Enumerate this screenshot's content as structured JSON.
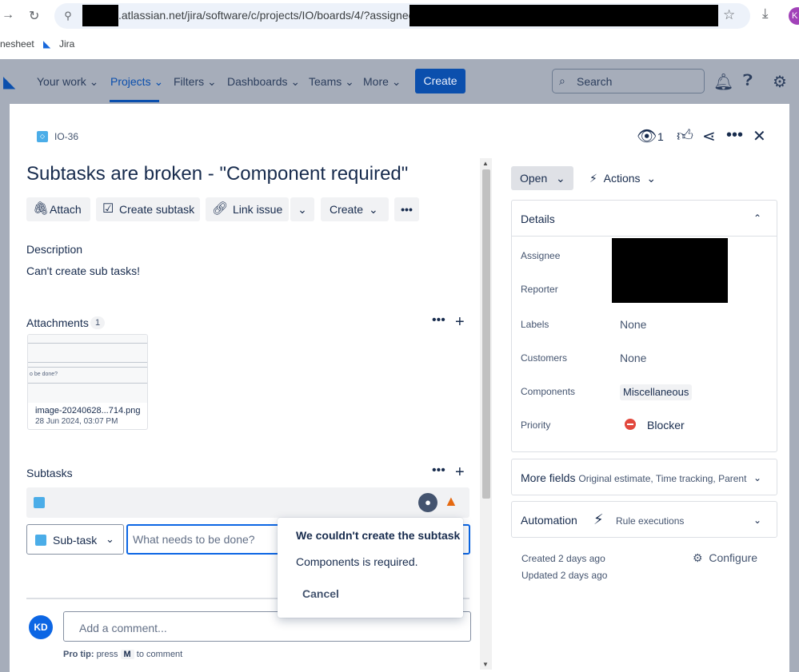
{
  "browser": {
    "url_visible": ".atlassian.net/jira/software/c/projects/IO/boards/4/?assignee=",
    "profile_initial": "K",
    "bookmarks": [
      "nesheet",
      "Jira"
    ]
  },
  "nav": {
    "items": [
      "Your work",
      "Projects",
      "Filters",
      "Dashboards",
      "Teams",
      "More"
    ],
    "create_label": "Create",
    "search_placeholder": "Search"
  },
  "issue": {
    "key": "IO-36",
    "watchers": "1",
    "title": "Subtasks are broken - \"Component required\"",
    "toolbar": {
      "attach": "Attach",
      "create_subtask": "Create subtask",
      "link_issue": "Link issue",
      "create": "Create",
      "more": "•••"
    },
    "description_label": "Description",
    "description_text": "Can't create sub tasks!",
    "attachments_label": "Attachments",
    "attachments_count": "1",
    "attachment": {
      "thumb_text": "o be done?",
      "name": "image-20240628...714.png",
      "date": "28 Jun 2024, 03:07 PM"
    },
    "subtasks_label": "Subtasks",
    "subtask_type": "Sub-task",
    "subtask_placeholder": "What needs to be done?",
    "comment_avatar": "KD",
    "comment_placeholder": "Add a comment...",
    "protip_prefix": "Pro tip:",
    "protip_press": "press",
    "protip_key": "M",
    "protip_suffix": "to comment"
  },
  "popup": {
    "title": "We couldn't create the subtask",
    "message": "Components is required.",
    "cancel": "Cancel"
  },
  "side": {
    "status": "Open",
    "actions": "Actions",
    "details_label": "Details",
    "fields": {
      "assignee": "Assignee",
      "reporter": "Reporter",
      "labels": "Labels",
      "labels_value": "None",
      "customers": "Customers",
      "customers_value": "None",
      "components": "Components",
      "components_value": "Miscellaneous",
      "priority": "Priority",
      "priority_value": "Blocker"
    },
    "more_fields": "More fields",
    "more_fields_sub": "Original estimate, Time tracking, Parent",
    "automation": "Automation",
    "automation_sub": "Rule executions",
    "created": "Created 2 days ago",
    "updated": "Updated 2 days ago",
    "configure": "Configure"
  },
  "colors": {
    "brand": "#0c66e4",
    "blocker": "#e2483d",
    "warning": "#e56910"
  }
}
